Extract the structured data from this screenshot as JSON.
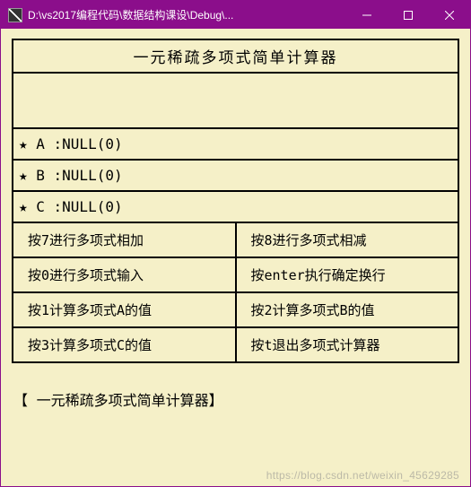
{
  "window": {
    "title": "D:\\vs2017编程代码\\数据结构课设\\Debug\\..."
  },
  "app": {
    "title": "一元稀疏多项式简单计算器",
    "polys": {
      "a": "★ A :NULL(0)",
      "b": "★ B :NULL(0)",
      "c": "★ C :NULL(0)"
    },
    "commands": {
      "r1c1": "按7进行多项式相加",
      "r1c2": "按8进行多项式相减",
      "r2c1": "按0进行多项式输入",
      "r2c2": "按enter执行确定换行",
      "r3c1": "按1计算多项式A的值",
      "r3c2": "按2计算多项式B的值",
      "r4c1": "按3计算多项式C的值",
      "r4c2": "按t退出多项式计算器"
    },
    "footer": "【 一元稀疏多项式简单计算器】"
  },
  "watermark": "https://blog.csdn.net/weixin_45629285"
}
